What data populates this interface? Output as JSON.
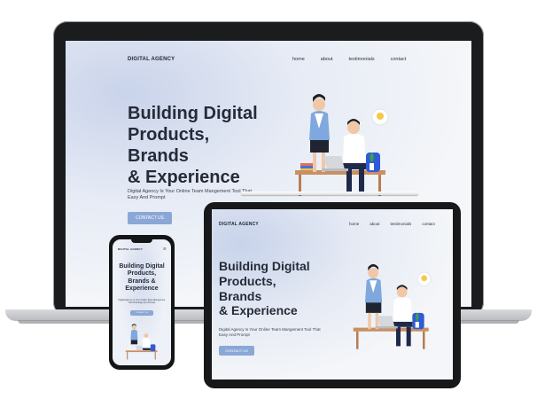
{
  "site": {
    "brand": "DIGITAL AGENCY",
    "nav": [
      "home",
      "about",
      "testimonials",
      "contact"
    ],
    "hero_lines": [
      "Building Digital",
      "Products,",
      "Brands",
      "& Experience"
    ],
    "subtitle": "Digital Agency Is Your Online Team Mangement Tool That Easy And Prompt",
    "cta": "CONTACT US",
    "menu_icon": "☰"
  },
  "colors": {
    "accent": "#8aa7d6",
    "heading": "#262b38",
    "device_frame": "#1b1c1e"
  },
  "icons": [
    "lightbulb-icon",
    "hamburger-menu-icon"
  ]
}
